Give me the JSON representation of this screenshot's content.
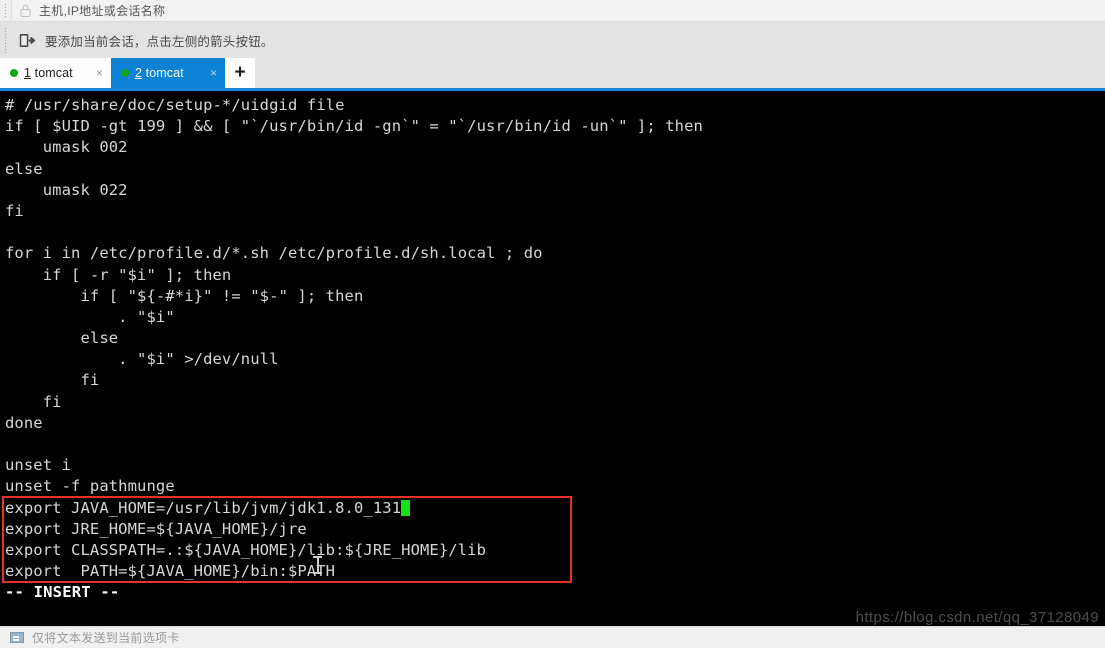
{
  "toolbar": {
    "address_placeholder": "主机,IP地址或会话名称",
    "lock_icon": "lock-icon",
    "hint_icon": "add-session-icon",
    "hint_text": "要添加当前会话，点击左侧的箭头按钮。"
  },
  "tabs": {
    "items": [
      {
        "number": "1",
        "name": "tomcat",
        "active": false,
        "status": "connected",
        "close_label": "×"
      },
      {
        "number": "2",
        "name": "tomcat",
        "active": true,
        "status": "connected",
        "close_label": "×"
      }
    ],
    "add_label": "+"
  },
  "terminal": {
    "lines": [
      "# /usr/share/doc/setup-*/uidgid file",
      "if [ $UID -gt 199 ] && [ \"`/usr/bin/id -gn`\" = \"`/usr/bin/id -un`\" ]; then",
      "    umask 002",
      "else",
      "    umask 022",
      "fi",
      "",
      "for i in /etc/profile.d/*.sh /etc/profile.d/sh.local ; do",
      "    if [ -r \"$i\" ]; then",
      "        if [ \"${-#*i}\" != \"$-\" ]; then",
      "            . \"$i\"",
      "        else",
      "            . \"$i\" >/dev/null",
      "        fi",
      "    fi",
      "done",
      "",
      "unset i",
      "unset -f pathmunge"
    ],
    "highlighted_lines": [
      "export JAVA_HOME=/usr/lib/jvm/jdk1.8.0_131",
      "export JRE_HOME=${JAVA_HOME}/jre",
      "export CLASSPATH=.:${JAVA_HOME}/lib:${JRE_HOME}/lib",
      "export  PATH=${JAVA_HOME}/bin:$PATH"
    ],
    "status_line": "-- INSERT --",
    "cursor_color": "#15e015",
    "highlight_color": "#e8312a",
    "text_color": "#d6d6d6",
    "background_color": "#000000"
  },
  "watermark": {
    "text": "https://blog.csdn.net/qq_37128049"
  },
  "statusbar": {
    "icon": "send-to-tab-icon",
    "text": "仅将文本发送到当前选项卡"
  }
}
